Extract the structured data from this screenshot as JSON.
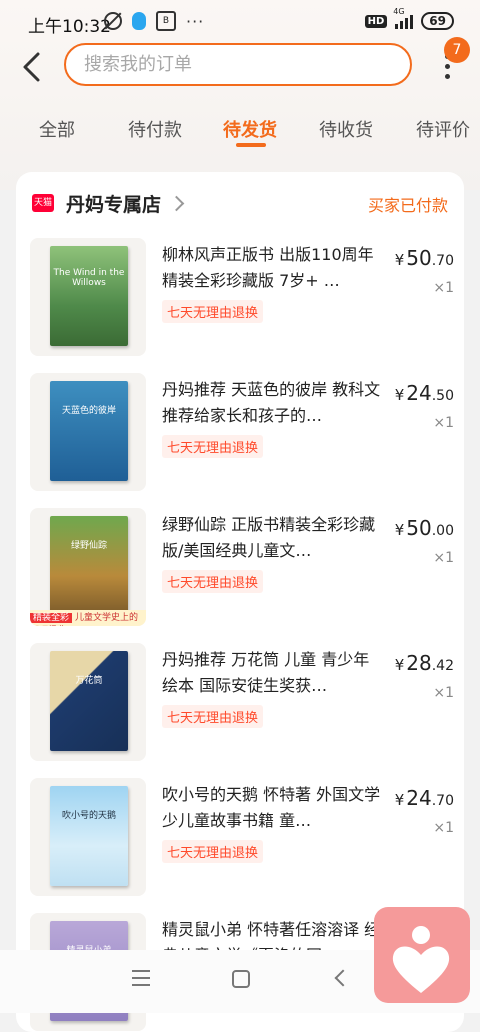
{
  "status_bar": {
    "time": "上午10:32",
    "hd": "HD",
    "network": "4G",
    "battery": "69"
  },
  "header": {
    "search_placeholder": "搜索我的订单",
    "notification_count": "7"
  },
  "tabs": [
    {
      "label": "全部"
    },
    {
      "label": "待付款"
    },
    {
      "label": "待发货"
    },
    {
      "label": "待收货"
    },
    {
      "label": "待评价"
    }
  ],
  "active_tab": "待发货",
  "order": {
    "store_badge": "天猫",
    "store_name": "丹妈专属店",
    "status": "买家已付款",
    "items": [
      {
        "title": "柳林风声正版书 出版110周年精装全彩珍藏版  7岁+ …",
        "cover_text": "The Wind in the Willows",
        "tag": "七天无理由退换",
        "price_currency": "¥",
        "price_int": "50",
        "price_dec": ".70",
        "qty": "×1"
      },
      {
        "title": "丹妈推荐  天蓝色的彼岸 教科文推荐给家长和孩子的…",
        "cover_text": "天蓝色的彼岸",
        "tag": "七天无理由退换",
        "price_currency": "¥",
        "price_int": "24",
        "price_dec": ".50",
        "qty": "×1"
      },
      {
        "title": "绿野仙踪 正版书精装全彩珍藏版/美国经典儿童文…",
        "cover_text": "绿野仙踪",
        "tag": "七天无理由退换",
        "price_currency": "¥",
        "price_int": "50",
        "price_dec": ".00",
        "qty": "×1",
        "promo_badge": "精装全彩",
        "promo_text": "儿童文学史上的不巧经典"
      },
      {
        "title": "丹妈推荐 万花筒 儿童 青少年 绘本 国际安徒生奖获…",
        "cover_text": "万花筒",
        "tag": "七天无理由退换",
        "price_currency": "¥",
        "price_int": "28",
        "price_dec": ".42",
        "qty": "×1"
      },
      {
        "title": "吹小号的天鹅 怀特著 外国文学少儿童故事书籍 童…",
        "cover_text": "吹小号的天鹅",
        "tag": "七天无理由退换",
        "price_currency": "¥",
        "price_int": "24",
        "price_dec": ".70",
        "qty": "×1"
      },
      {
        "title": "精灵鼠小弟 怀特著任溶溶译 经典儿童文学《夏洛的网…",
        "cover_text": "精灵鼠小弟"
      }
    ]
  },
  "colors": {
    "accent": "#f36b1c",
    "tag_red": "#ff4a2b",
    "tmall_red": "#ff0036"
  }
}
